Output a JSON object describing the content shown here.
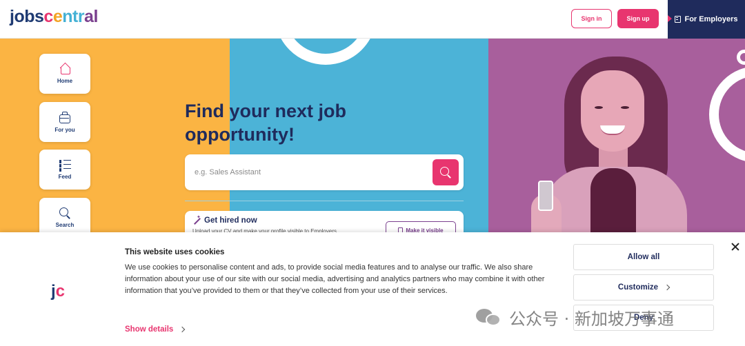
{
  "header": {
    "logo_parts": [
      "jobs",
      "c",
      "e",
      "ntr",
      "al"
    ],
    "signin_label": "Sign in",
    "signup_label": "Sign up",
    "employers_label": "For Employers"
  },
  "sidebar": {
    "items": [
      {
        "label": "Home",
        "icon": "home-icon"
      },
      {
        "label": "For you",
        "icon": "briefcase-icon"
      },
      {
        "label": "Feed",
        "icon": "feed-icon"
      },
      {
        "label": "Search",
        "icon": "search-icon"
      }
    ]
  },
  "hero": {
    "headline": "Find your next job opportunity!",
    "search_placeholder": "e.g. Sales Assistant",
    "hired_title": "Get hired now",
    "hired_subtitle": "Upload your CV and make your profile visible to Employers",
    "visible_button": "Make it visible"
  },
  "cookie": {
    "logo_j": "j",
    "logo_c": "c",
    "title": "This website uses cookies",
    "text": "We use cookies to personalise content and ads, to provide social media features and to analyse our traffic. We also share information about your use of our site with our social media, advertising and analytics partners who may combine it with other information that you’ve provided to them or that they’ve collected from your use of their services.",
    "show_details": "Show details",
    "allow_all": "Allow all",
    "customize": "Customize",
    "deny": "Deny"
  },
  "watermark": {
    "text": "公众号 · 新加坡万事通"
  },
  "colors": {
    "brand_pink": "#e8356f",
    "navy": "#1f2b5c",
    "yellow": "#fbb443",
    "blue": "#4cb3d7",
    "purple": "#a85f9c"
  }
}
